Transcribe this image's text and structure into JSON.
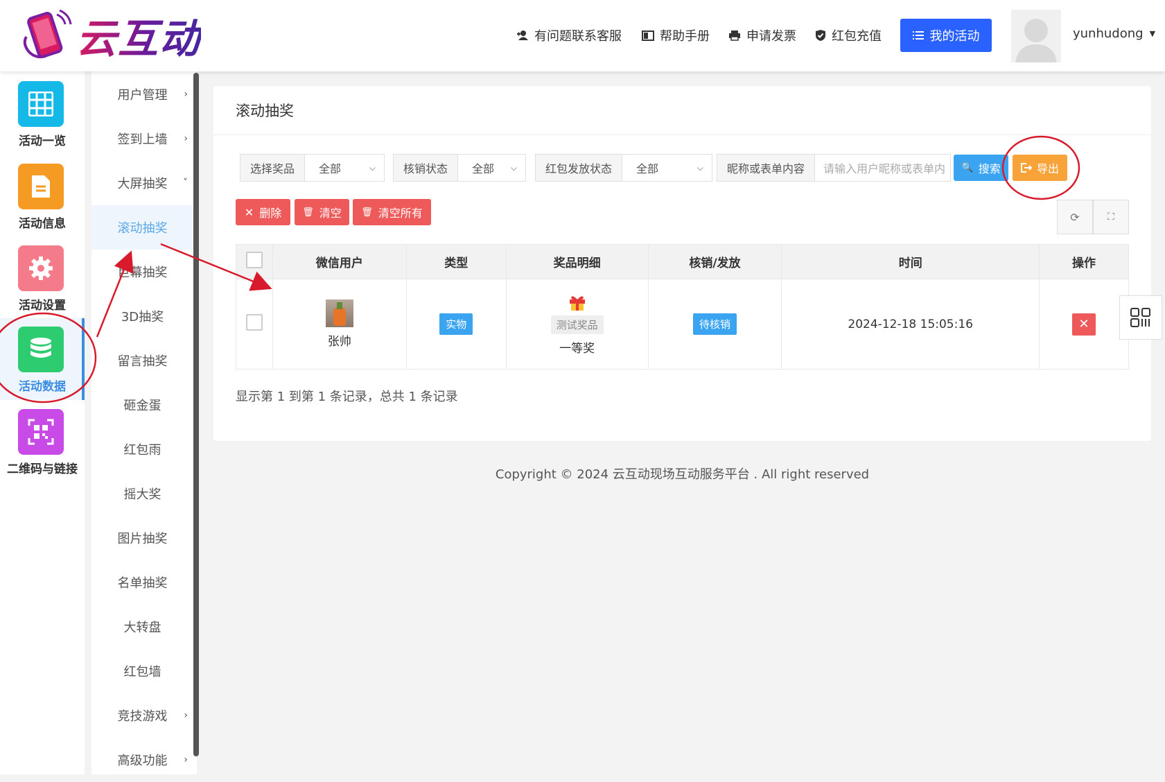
{
  "header": {
    "logo_text": "云互动",
    "nav": [
      {
        "label": "有问题联系客服",
        "icon": "user-plus-icon"
      },
      {
        "label": "帮助手册",
        "icon": "book-icon"
      },
      {
        "label": "申请发票",
        "icon": "printer-icon"
      },
      {
        "label": "红包充值",
        "icon": "shield-check-icon"
      }
    ],
    "my_activity": "我的活动",
    "username": "yunhudong"
  },
  "iconbar": [
    {
      "label": "活动一览",
      "color": "#14b9e8",
      "icon": "grid-icon"
    },
    {
      "label": "活动信息",
      "color": "#f59a23",
      "icon": "document-icon"
    },
    {
      "label": "活动设置",
      "color": "#f47b8a",
      "icon": "gear-icon"
    },
    {
      "label": "活动数据",
      "color": "#2ecc71",
      "icon": "database-icon",
      "active": true
    },
    {
      "label": "二维码与链接",
      "color": "#c84be8",
      "icon": "qrcode-icon"
    }
  ],
  "submenu": [
    {
      "label": "用户管理",
      "chevron": "›"
    },
    {
      "label": "签到上墙",
      "chevron": "›"
    },
    {
      "label": "大屏抽奖",
      "chevron": "˅"
    },
    {
      "label": "滚动抽奖",
      "active": true
    },
    {
      "label": "巨幕抽奖"
    },
    {
      "label": "3D抽奖"
    },
    {
      "label": "留言抽奖"
    },
    {
      "label": "砸金蛋"
    },
    {
      "label": "红包雨"
    },
    {
      "label": "摇大奖"
    },
    {
      "label": "图片抽奖"
    },
    {
      "label": "名单抽奖"
    },
    {
      "label": "大转盘"
    },
    {
      "label": "红包墙"
    },
    {
      "label": "竞技游戏",
      "chevron": "›"
    },
    {
      "label": "高级功能",
      "chevron": "›"
    }
  ],
  "page": {
    "title": "滚动抽奖",
    "filters": {
      "prize_label": "选择奖品",
      "prize_value": "全部",
      "verify_label": "核销状态",
      "verify_value": "全部",
      "redpack_label": "红包发放状态",
      "redpack_value": "全部",
      "keyword_label": "昵称或表单内容",
      "keyword_placeholder": "请输入用户昵称或表单内"
    },
    "search": "搜索",
    "export": "导出",
    "delete": "删除",
    "clear": "清空",
    "clear_all": "清空所有",
    "columns": [
      "微信用户",
      "类型",
      "奖品明细",
      "核销/发放",
      "时间",
      "操作"
    ],
    "rows": [
      {
        "user": "张帅",
        "type": "实物",
        "prize_name": "测试奖品",
        "prize_level": "一等奖",
        "status": "待核销",
        "time": "2024-12-18 15:05:16"
      }
    ],
    "summary": "显示第 1 到第 1 条记录，总共 1 条记录"
  },
  "footer": {
    "copyright": "Copyright © 2024 云互动现场互动服务平台 . All right reserved"
  },
  "annotation_color": "#d81b2c"
}
